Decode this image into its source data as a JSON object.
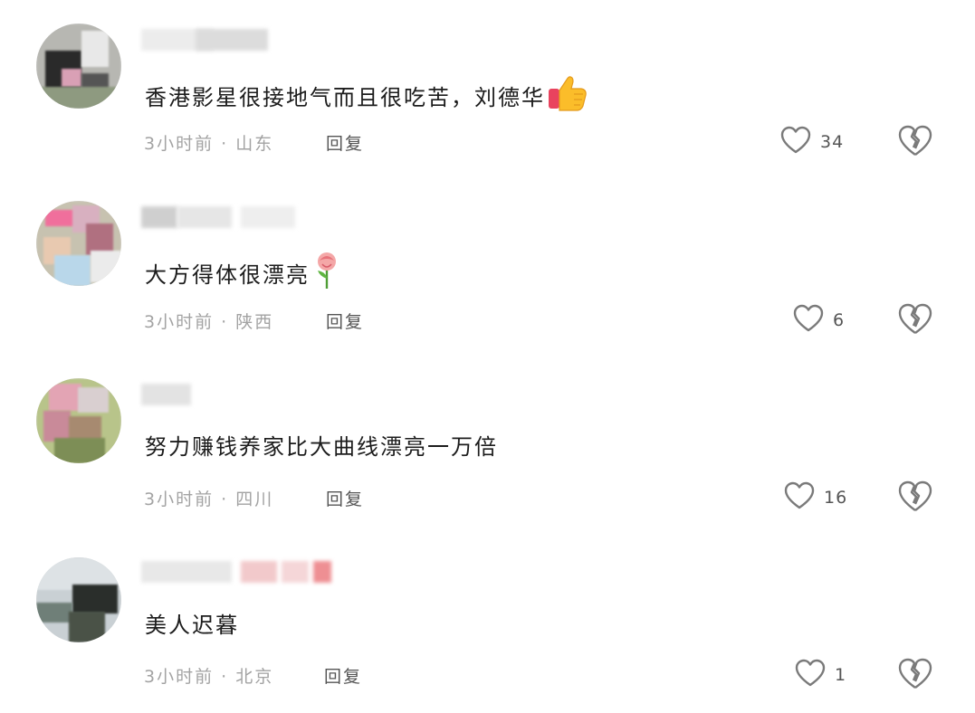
{
  "comments": [
    {
      "username": "**********",
      "text": "香港影星很接地气而且很吃苦，刘德华",
      "emoji": "thumbs-up-emoji",
      "time": "3小时前",
      "location": "山东",
      "reply_label": "回复",
      "likes": "34"
    },
    {
      "username": "**********",
      "text": "大方得体很漂亮",
      "emoji": "rose-emoji",
      "time": "3小时前",
      "location": "陕西",
      "reply_label": "回复",
      "likes": "6"
    },
    {
      "username": "**********",
      "text": "努力赚钱养家比大曲线漂亮一万倍",
      "time": "3小时前",
      "location": "四川",
      "reply_label": "回复",
      "likes": "16"
    },
    {
      "username": "**********",
      "text": "美人迟暮",
      "time": "3小时前",
      "location": "北京",
      "reply_label": "回复",
      "likes": "1"
    }
  ],
  "separator": " · ",
  "colors": {
    "meta_text": "#a3a3a3",
    "icon_stroke": "#7a7a7a",
    "main_text": "#1c1c1c"
  }
}
